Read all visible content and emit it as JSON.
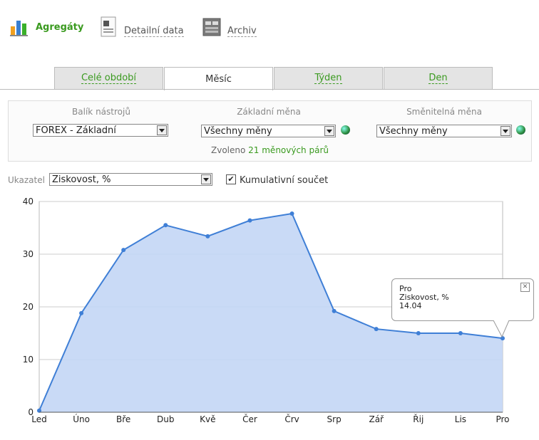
{
  "nav": [
    {
      "label": "Agregáty",
      "icon": "bar-chart-icon",
      "active": true
    },
    {
      "label": "Detailní data",
      "icon": "document-icon",
      "active": false
    },
    {
      "label": "Archiv",
      "icon": "archive-icon",
      "active": false
    }
  ],
  "tabs": [
    "Celé období",
    "Měsíc",
    "Týden",
    "Den"
  ],
  "active_tab": "Měsíc",
  "filters": {
    "toolkit_label": "Balík nástrojů",
    "toolkit_value": "FOREX - Základní",
    "base_label": "Základní měna",
    "base_value": "Všechny měny",
    "counter_label": "Směnitelná měna",
    "counter_value": "Všechny měny",
    "selected_prefix": "Zvoleno ",
    "selected_count": "21 měnových párů"
  },
  "indicator": {
    "label": "Ukazatel",
    "value": "Ziskovost, %",
    "cumulative_label": "Kumulativní součet",
    "cumulative_checked": true
  },
  "chart_data": {
    "type": "area",
    "categories": [
      "Led",
      "Úno",
      "Bře",
      "Dub",
      "Kvě",
      "Čer",
      "Črv",
      "Srp",
      "Zář",
      "Řij",
      "Lis",
      "Pro"
    ],
    "series": [
      {
        "values": [
          0.3,
          18.8,
          30.8,
          35.5,
          33.4,
          36.4,
          37.7,
          19.2,
          15.8,
          15.0,
          15.0,
          14.04
        ]
      }
    ],
    "ylim": [
      0,
      40
    ],
    "yticks": [
      0,
      10,
      20,
      30,
      40
    ],
    "grid": true,
    "colors": {
      "line": "#3f7fd6",
      "fill": "#c3d6f5"
    }
  },
  "tooltip": {
    "category": "Pro",
    "series": "Ziskovost, %",
    "value": "14.04",
    "close_glyph": "✕"
  }
}
